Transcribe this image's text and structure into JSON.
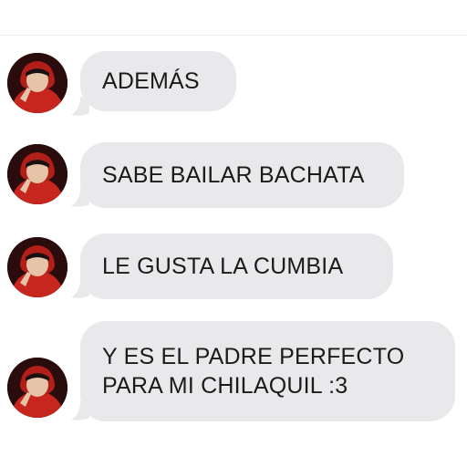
{
  "conversation": {
    "messages": [
      {
        "lines": [
          "ADEMÁS"
        ]
      },
      {
        "lines": [
          "SABE BAILAR BACHATA"
        ]
      },
      {
        "lines": [
          "LE GUSTA LA CUMBIA"
        ]
      },
      {
        "lines": [
          "Y ES EL PADRE PERFECTO",
          "PARA MI CHILAQUIL :3"
        ]
      }
    ]
  },
  "style": {
    "bubble_color": "#e9e9eb",
    "text_color": "#1b1b1b",
    "hoodie_color": "#c7261e"
  },
  "icons": {
    "avatar": "profile-photo-person-red-hoodie"
  }
}
